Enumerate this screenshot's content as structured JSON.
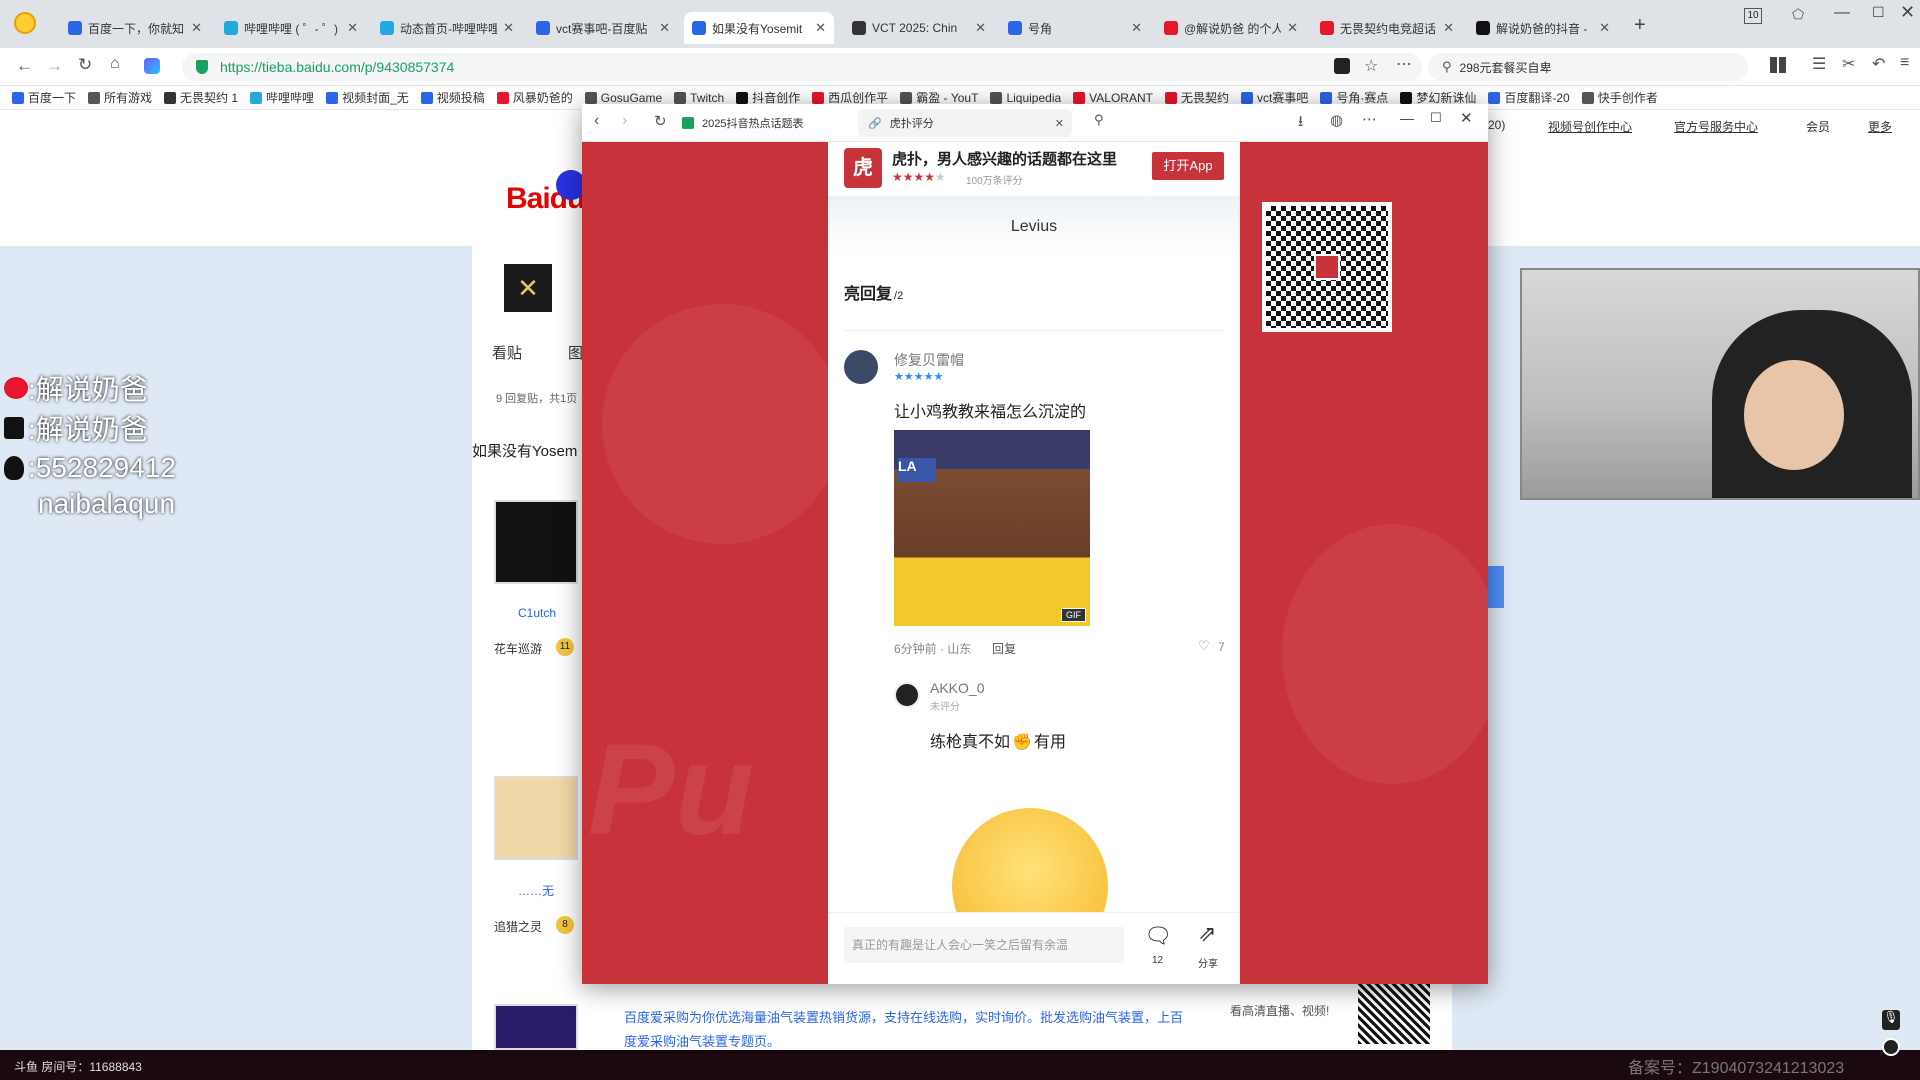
{
  "tabs": [
    {
      "label": "百度一下，你就知",
      "color": "#2b65e8"
    },
    {
      "label": "哔哩哔哩 ( ゜- ゜)",
      "color": "#23a8e0"
    },
    {
      "label": "动态首页-哔哩哔哩",
      "color": "#23a8e0"
    },
    {
      "label": "vct赛事吧-百度贴",
      "color": "#2b65e8"
    },
    {
      "label": "如果没有Yosemit",
      "color": "#2b65e8"
    },
    {
      "label": "VCT 2025: Chin",
      "color": "#333333"
    },
    {
      "label": "号角",
      "color": "#2b65e8"
    },
    {
      "label": "@解说奶爸 的个人",
      "color": "#e6162d"
    },
    {
      "label": "无畏契约电竞超话",
      "color": "#e6162d"
    },
    {
      "label": "解说奶爸的抖音 -",
      "color": "#111111"
    }
  ],
  "window_badge": "10",
  "url": "https://tieba.baidu.com/p/9430857374",
  "search_text": "298元套餐买自卑",
  "bookmarks": [
    "百度一下",
    "所有游戏",
    "无畏契约 1",
    "哔哩哔哩",
    "视频封面_无",
    "视频投稿",
    "风暴奶爸的",
    "GosuGame",
    "Twitch",
    "抖音创作",
    "西瓜创作平",
    "霸盈 - YouT",
    "Liquipedia",
    "VALORANT",
    "无畏契约",
    "vct赛事吧",
    "号角·赛点",
    "梦幻新诛仙",
    "百度翻译-20",
    "快手创作者"
  ],
  "tieba": {
    "logo": "Baidu",
    "tab_view": "看贴",
    "tab_pic": "图",
    "reply_count": "9 回复贴，共1页",
    "thread_title": "如果没有Yosem",
    "user1": "C1utch",
    "user1_badge": "花车巡游",
    "user1_level": "11",
    "user2": "……无",
    "user2_badge": "追猎之灵",
    "user2_level": "8",
    "ad_text": "百度爱采购为你优选海量油气装置热销货源，支持在线选购，实时询价。批发选购油气装置，上百度爱采购油气装置专题页。",
    "right_text": "看高清直播、视频!",
    "top_links": [
      "视频号创作中心",
      "官方号服务中心",
      "会员",
      "更多"
    ],
    "top_badge": "(20)"
  },
  "overlay": {
    "tab1": "2025抖音热点话题表",
    "tab2": "虎扑评分",
    "app_title": "虎扑，男人感兴趣的话题都在这里",
    "rating_count": "100万条评分",
    "open_app": "打开App",
    "author": "Levius",
    "section": "亮回复",
    "section_count": "/2",
    "c1_user": "修复贝雷帽",
    "c1_text": "让小鸡教教来福怎么沉淀的",
    "c1_meta_time": "6分钟前",
    "c1_meta_loc": "山东",
    "c1_reply": "回复",
    "c1_likes": "7",
    "gif": "GIF",
    "c2_user": "AKKO_0",
    "c2_sub": "未评分",
    "c2_text_a": "练枪真不如",
    "c2_text_b": "有用",
    "input_placeholder": "真正的有趣是让人会心一笑之后留有余温",
    "comment_count": "12",
    "share": "分享"
  },
  "social": [
    {
      "icon": "weibo-icon",
      "text": ":解说奶爸"
    },
    {
      "icon": "douyin-icon",
      "text": ":解说奶爸"
    },
    {
      "icon": "qq-icon",
      "text": ":552829412"
    },
    {
      "icon": "none",
      "text": "naibalaqun"
    }
  ],
  "status": {
    "room": "斗鱼 房间号：11688843",
    "record": "备案号：Z1904073241213023"
  },
  "colors": {
    "hupu_red": "#c8323a",
    "link_blue": "#2b65e8"
  }
}
